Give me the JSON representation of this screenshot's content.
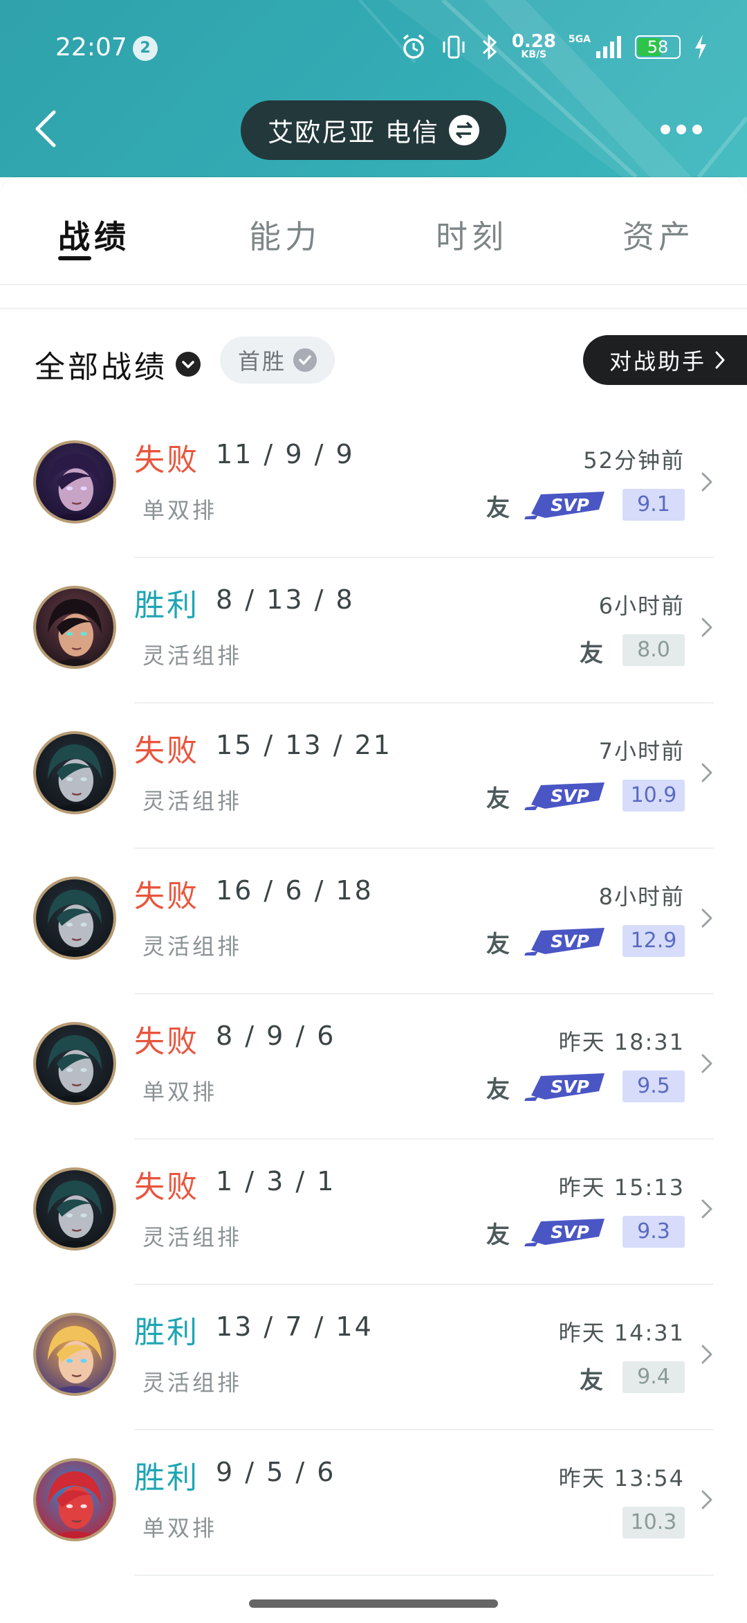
{
  "status_bar": {
    "time": "22:07",
    "notification_count": "2",
    "net_speed": "0.28",
    "net_unit": "KB/S",
    "network": "5GA",
    "battery": "58",
    "battery_level": 0.58
  },
  "header": {
    "server_name": "艾欧尼亚 电信"
  },
  "tabs": [
    {
      "label": "战绩",
      "active": true
    },
    {
      "label": "能力",
      "active": false
    },
    {
      "label": "时刻",
      "active": false
    },
    {
      "label": "资产",
      "active": false
    }
  ],
  "filters": {
    "all_records": "全部战绩",
    "first_win": "首胜",
    "helper": "对战助手"
  },
  "matches": [
    {
      "result": "失败",
      "kda": "11 / 9 / 9",
      "mode": "单双排",
      "time": "52分钟前",
      "friend": true,
      "svp": true,
      "score": "9.1"
    },
    {
      "result": "胜利",
      "kda": "8 / 13 / 8",
      "mode": "灵活组排",
      "time": "6小时前",
      "friend": true,
      "svp": false,
      "score": "8.0"
    },
    {
      "result": "失败",
      "kda": "15 / 13 / 21",
      "mode": "灵活组排",
      "time": "7小时前",
      "friend": true,
      "svp": true,
      "score": "10.9"
    },
    {
      "result": "失败",
      "kda": "16 / 6 / 18",
      "mode": "灵活组排",
      "time": "8小时前",
      "friend": true,
      "svp": true,
      "score": "12.9"
    },
    {
      "result": "失败",
      "kda": "8 / 9 / 6",
      "mode": "单双排",
      "time": "昨天 18:31",
      "friend": true,
      "svp": true,
      "score": "9.5"
    },
    {
      "result": "失败",
      "kda": "1 / 3 / 1",
      "mode": "灵活组排",
      "time": "昨天 15:13",
      "friend": true,
      "svp": true,
      "score": "9.3"
    },
    {
      "result": "胜利",
      "kda": "13 / 7 / 14",
      "mode": "灵活组排",
      "time": "昨天 14:31",
      "friend": true,
      "svp": false,
      "score": "9.4"
    },
    {
      "result": "胜利",
      "kda": "9 / 5 / 6",
      "mode": "单双排",
      "time": "昨天 13:54",
      "friend": false,
      "svp": false,
      "score": "10.3"
    }
  ],
  "colors": {
    "win": "#1ea5b4",
    "loss": "#e8563d",
    "header": "#33aab3"
  }
}
